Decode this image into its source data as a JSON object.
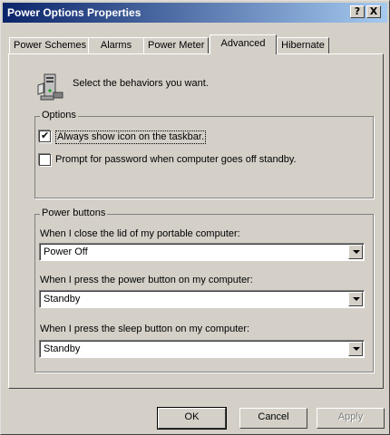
{
  "window": {
    "title": "Power Options Properties",
    "help_label": "?",
    "close_label": "X"
  },
  "tabs": [
    {
      "label": "Power Schemes",
      "active": false
    },
    {
      "label": "Alarms",
      "active": false
    },
    {
      "label": "Power Meter",
      "active": false
    },
    {
      "label": "Advanced",
      "active": true
    },
    {
      "label": "Hibernate",
      "active": false
    }
  ],
  "advanced": {
    "intro_text": "Select the behaviors you want.",
    "icon": "computer-settings-icon",
    "options": {
      "legend": "Options",
      "show_icon": {
        "label": "Always show icon on the taskbar.",
        "checked": true
      },
      "prompt_password": {
        "label": "Prompt for password when computer goes off standby.",
        "checked": false
      }
    },
    "power_buttons": {
      "legend": "Power buttons",
      "lid": {
        "label": "When I close the lid of my portable computer:",
        "value": "Power Off"
      },
      "power_button": {
        "label": "When I press the power button on my computer:",
        "value": "Standby"
      },
      "sleep_button": {
        "label": "When I press the sleep button on my computer:",
        "value": "Standby"
      }
    }
  },
  "buttons": {
    "ok": "OK",
    "cancel": "Cancel",
    "apply": "Apply",
    "apply_enabled": false
  },
  "colors": {
    "titlebar_start": "#0a246a",
    "titlebar_end": "#a6caf0",
    "face": "#d4d0c8"
  }
}
